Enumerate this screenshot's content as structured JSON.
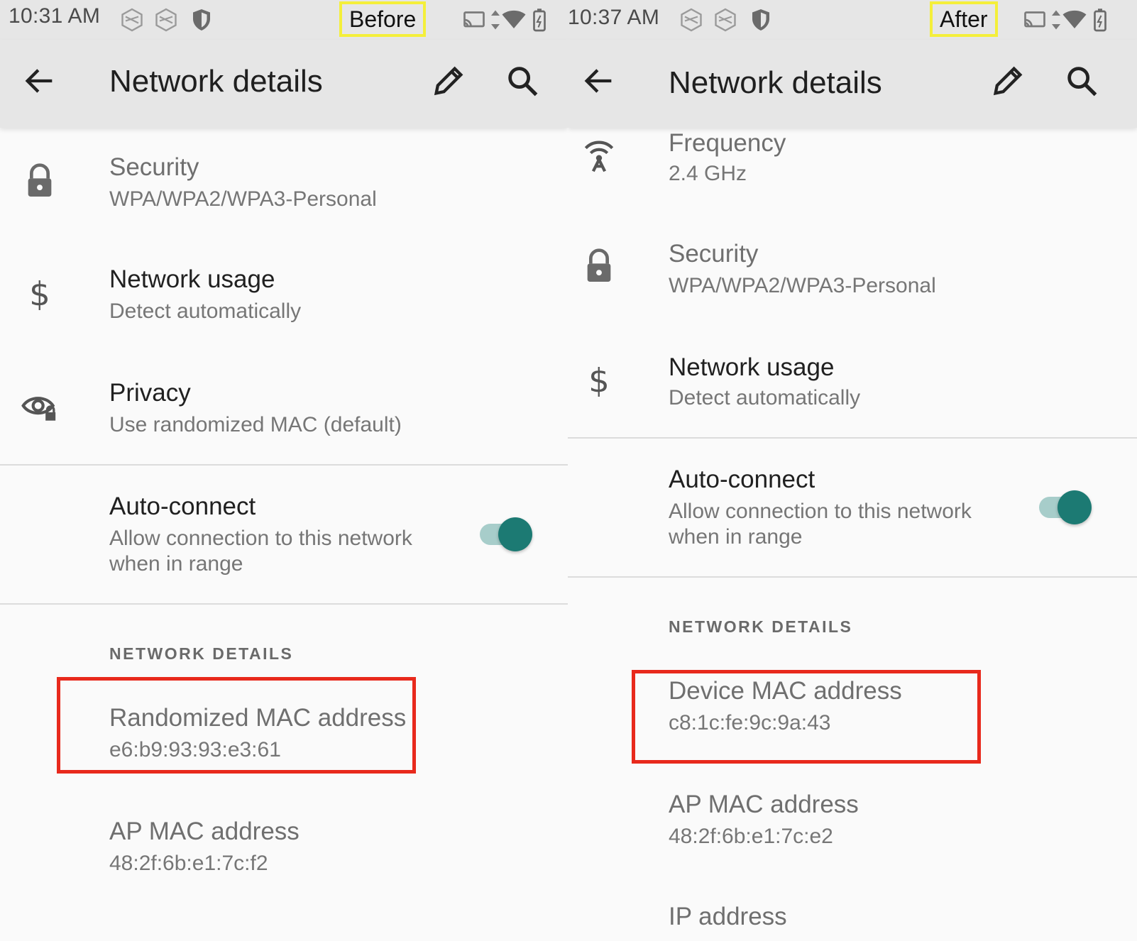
{
  "before": {
    "status_time": "10:31 AM",
    "compare_label": "Before",
    "appbar_title": "Network details",
    "rows": [
      {
        "title": "Security",
        "subtitle": "WPA/WPA2/WPA3-Personal",
        "icon": "lock-icon"
      },
      {
        "title": "Network usage",
        "subtitle": "Detect automatically",
        "icon": "dollar-icon"
      },
      {
        "title": "Privacy",
        "subtitle": "Use randomized MAC (default)",
        "icon": "privacy-eye-icon"
      }
    ],
    "autoconnect": {
      "title": "Auto-connect",
      "subtitle_line1": "Allow connection to this network",
      "subtitle_line2": "when in range",
      "on": true
    },
    "section_header": "NETWORK DETAILS",
    "details": [
      {
        "title": "Randomized MAC address",
        "value": "e6:b9:93:93:e3:61",
        "highlighted": true
      },
      {
        "title": "AP MAC address",
        "value": "48:2f:6b:e1:7c:f2"
      }
    ]
  },
  "after": {
    "status_time": "10:37 AM",
    "compare_label": "After",
    "appbar_title": "Network details",
    "rows": [
      {
        "title": "Frequency",
        "subtitle": "2.4 GHz",
        "icon": "antenna-icon"
      },
      {
        "title": "Security",
        "subtitle": "WPA/WPA2/WPA3-Personal",
        "icon": "lock-icon"
      },
      {
        "title": "Network usage",
        "subtitle": "Detect automatically",
        "icon": "dollar-icon"
      }
    ],
    "autoconnect": {
      "title": "Auto-connect",
      "subtitle_line1": "Allow connection to this network",
      "subtitle_line2": "when in range",
      "on": true
    },
    "section_header": "NETWORK DETAILS",
    "details": [
      {
        "title": "Device MAC address",
        "value": "c8:1c:fe:9c:9a:43",
        "highlighted": true
      },
      {
        "title": "AP MAC address",
        "value": "48:2f:6b:e1:7c:e2"
      },
      {
        "title": "IP address"
      }
    ]
  },
  "colors": {
    "accent": "#1c7a73",
    "highlight_red": "#e8291c",
    "label_yellow": "#f4ef3a"
  }
}
